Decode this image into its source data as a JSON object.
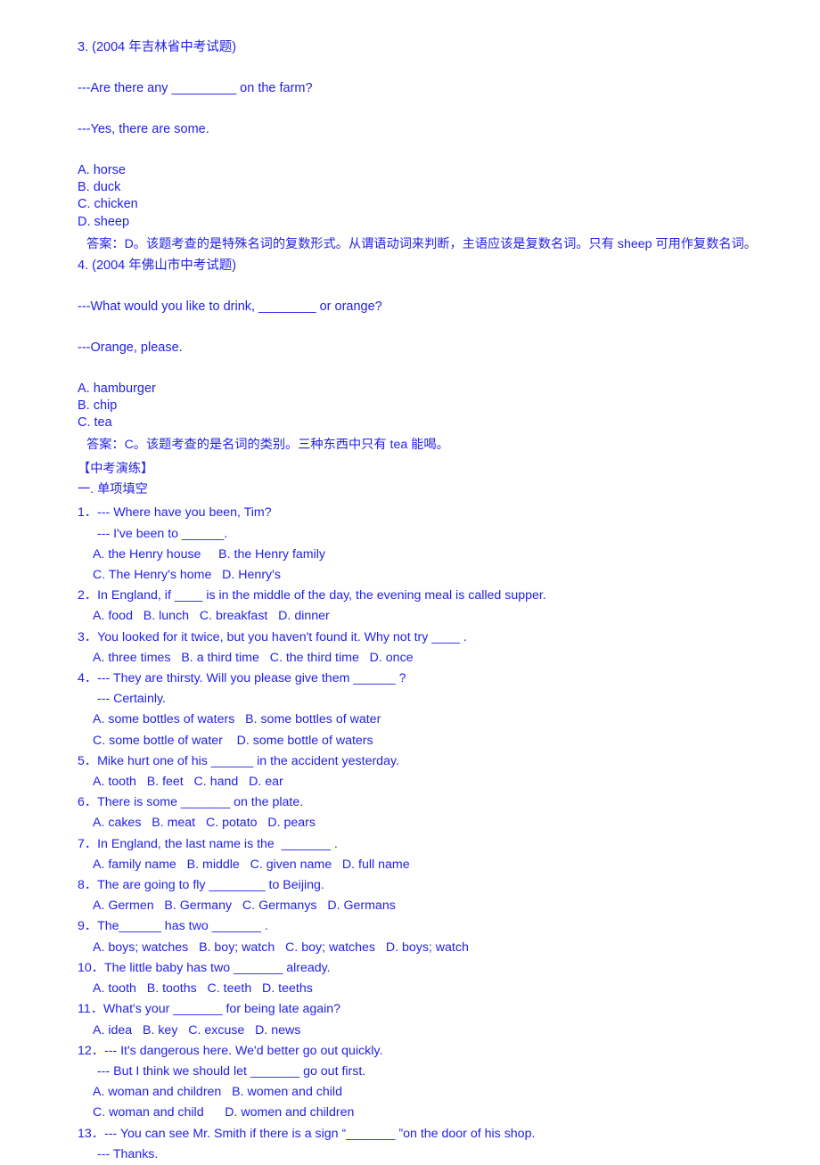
{
  "document": {
    "text_color": "#1f1fe8",
    "background_color": "#ffffff",
    "worked_examples": [
      {
        "heading": "3. (2004 年吉林省中考试题)",
        "question": "---Are there any _________ on the farm?",
        "answer_line": "---Yes, there are some.",
        "options": [
          "A. horse",
          "B. duck",
          "C. chicken",
          "D. sheep"
        ],
        "explanation": "答案：D。该题考查的是特殊名词的复数形式。从谓语动词来判断，主语应该是复数名词。只有 sheep 可用作复数名词。"
      },
      {
        "heading": "4. (2004 年佛山市中考试题)",
        "question": "---What would you like to drink, ________ or orange?",
        "answer_line": "---Orange, please.",
        "options": [
          "A. hamburger",
          "B. chip",
          "C. tea"
        ],
        "explanation": "答案：C。该题考查的是名词的类别。三种东西中只有 tea 能喝。"
      }
    ],
    "section": {
      "tag": "【中考演练】",
      "subtitle": "一. 单项填空"
    },
    "questions": [
      {
        "stem": "1．--- Where have you been, Tim?",
        "cont": [
          "--- I've been to ______."
        ],
        "options": [
          "A. the Henry house     B. the Henry family",
          "C. The Henry's home   D. Henry's"
        ]
      },
      {
        "stem": "2．In England, if ____ is in the middle of the day, the evening meal is called supper.",
        "cont": [],
        "options": [
          "A. food   B. lunch   C. breakfast   D. dinner"
        ]
      },
      {
        "stem": "3．You looked for it twice, but you haven't found it. Why not try ____ .",
        "cont": [],
        "options": [
          "A. three times   B. a third time   C. the third time   D. once"
        ]
      },
      {
        "stem": "4．--- They are thirsty. Will you please give them ______ ?",
        "cont": [
          "--- Certainly."
        ],
        "options": [
          "A. some bottles of waters   B. some bottles of water",
          "C. some bottle of water    D. some bottle of waters"
        ]
      },
      {
        "stem": "5．Mike hurt one of his ______ in the accident yesterday.",
        "cont": [],
        "options": [
          "A. tooth   B. feet   C. hand   D. ear"
        ]
      },
      {
        "stem": "6．There is some _______ on the plate.",
        "cont": [],
        "options": [
          "A. cakes   B. meat   C. potato   D. pears"
        ]
      },
      {
        "stem": "7．In England, the last name is the  _______ .",
        "cont": [],
        "options": [
          "A. family name   B. middle   C. given name   D. full name"
        ]
      },
      {
        "stem": "8．The are going to fly ________ to Beijing.",
        "cont": [],
        "options": [
          "A. Germen   B. Germany   C. Germanys   D. Germans"
        ]
      },
      {
        "stem": "9．The______ has two _______ .",
        "cont": [],
        "options": [
          "A. boys; watches   B. boy; watch   C. boy; watches   D. boys; watch"
        ]
      },
      {
        "stem": "10．The little baby has two _______ already.",
        "cont": [],
        "options": [
          "A. tooth   B. tooths   C. teeth   D. teeths"
        ]
      },
      {
        "stem": "11．What's your _______ for being late again?",
        "cont": [],
        "options": [
          "A. idea   B. key   C. excuse   D. news"
        ]
      },
      {
        "stem": "12．--- It's dangerous here. We'd better go out quickly.",
        "cont": [
          "--- But I think we should let _______ go out first."
        ],
        "options": [
          "A. woman and children   B. women and child",
          "C. woman and child      D. women and children"
        ]
      },
      {
        "stem": "13．--- You can see Mr. Smith if there is a sign “_______ ”on the door of his shop.",
        "cont": [
          "--- Thanks."
        ],
        "options": []
      }
    ]
  }
}
